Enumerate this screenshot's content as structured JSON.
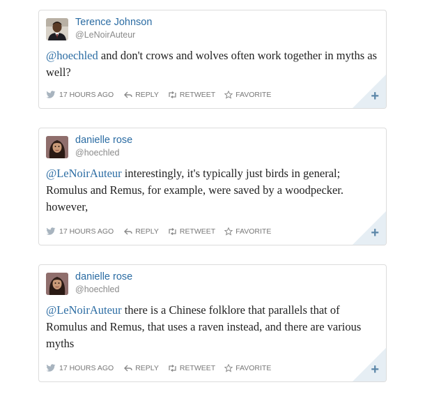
{
  "actions": {
    "reply": "REPLY",
    "retweet": "RETWEET",
    "favorite": "FAVORITE"
  },
  "tweets": [
    {
      "user": {
        "name": "Terence Johnson",
        "handle": "@LeNoirAuteur"
      },
      "mention": "@hoechled",
      "text": " and don't crows and wolves often work together in myths as well?",
      "timestamp": "17 HOURS AGO"
    },
    {
      "user": {
        "name": "danielle rose",
        "handle": "@hoechled"
      },
      "mention": "@LeNoirAuteur",
      "text": " interestingly, it's typically just birds in general; Romulus and Remus, for example, were saved by a woodpecker. however,",
      "timestamp": "17 HOURS AGO"
    },
    {
      "user": {
        "name": "danielle rose",
        "handle": "@hoechled"
      },
      "mention": "@LeNoirAuteur",
      "text": " there is a Chinese folklore that parallels that of Romulus and Remus, that uses a raven instead, and there are various myths",
      "timestamp": "17 HOURS AGO"
    }
  ],
  "expand_symbol": "+",
  "colors": {
    "link": "#2b6ca3",
    "handle": "#8a8a8a",
    "text": "#222222",
    "action": "#777777",
    "corner": "#e6eef4",
    "border": "#dcdcdc"
  },
  "icons": [
    "bird-icon",
    "reply-arrow-icon",
    "retweet-icon",
    "star-icon",
    "plus-icon"
  ]
}
